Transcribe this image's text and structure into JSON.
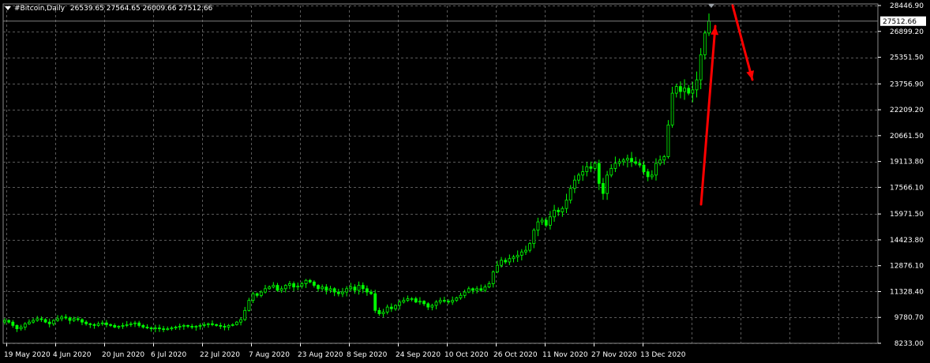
{
  "header": {
    "symbol": "#Bitcoin,Daily",
    "ohlc": "26539.65 27564.65 26009.66 27512.66"
  },
  "price_label": "27512.66",
  "colors": {
    "background": "#000000",
    "grid": "#5a5a5a",
    "candle": "#00ff00",
    "arrow": "#ff0000",
    "current_price_line": "#7f7f7f"
  },
  "chart_data": {
    "type": "candlestick",
    "symbol": "#Bitcoin",
    "timeframe": "Daily",
    "ylim": [
      8233.0,
      28446.9
    ],
    "y_ticks": [
      "28446.90",
      "26899.20",
      "25351.50",
      "23756.90",
      "22209.20",
      "20661.50",
      "19113.80",
      "17566.10",
      "15971.50",
      "14423.80",
      "12876.10",
      "11328.40",
      "9780.70",
      "8233.00"
    ],
    "y_tick_values": [
      28446.9,
      26899.2,
      25351.5,
      23756.9,
      22209.2,
      20661.5,
      19113.8,
      17566.1,
      15971.5,
      14423.8,
      12876.1,
      11328.4,
      9780.7,
      8233.0
    ],
    "x_ticks": [
      "19 May 2020",
      "4 Jun 2020",
      "20 Jun 2020",
      "6 Jul 2020",
      "22 Jul 2020",
      "7 Aug 2020",
      "23 Aug 2020",
      "8 Sep 2020",
      "24 Sep 2020",
      "10 Oct 2020",
      "26 Oct 2020",
      "11 Nov 2020",
      "27 Nov 2020",
      "13 Dec 2020"
    ],
    "grid": true,
    "last_price": 27512.66,
    "close_series": [
      9600,
      9500,
      9300,
      9100,
      9200,
      9400,
      9500,
      9600,
      9700,
      9650,
      9500,
      9400,
      9600,
      9700,
      9800,
      9750,
      9600,
      9700,
      9650,
      9500,
      9400,
      9350,
      9300,
      9400,
      9450,
      9350,
      9300,
      9200,
      9250,
      9300,
      9350,
      9400,
      9450,
      9300,
      9200,
      9150,
      9100,
      9150,
      9100,
      9050,
      9100,
      9150,
      9200,
      9250,
      9300,
      9250,
      9200,
      9250,
      9300,
      9350,
      9400,
      9350,
      9300,
      9250,
      9200,
      9300,
      9350,
      9500,
      9650,
      10200,
      10800,
      11200,
      11100,
      11300,
      11500,
      11600,
      11700,
      11400,
      11500,
      11700,
      11800,
      11600,
      11650,
      11800,
      12000,
      11900,
      11700,
      11500,
      11600,
      11400,
      11500,
      11300,
      11200,
      11300,
      11500,
      11600,
      11400,
      11700,
      11500,
      11300,
      11200,
      10200,
      10000,
      10100,
      10400,
      10300,
      10500,
      10700,
      10800,
      10900,
      10900,
      10700,
      10750,
      10600,
      10400,
      10500,
      10700,
      10800,
      10750,
      10700,
      10800,
      10950,
      11100,
      11300,
      11500,
      11400,
      11500,
      11400,
      11600,
      11800,
      12500,
      12900,
      13200,
      13100,
      13300,
      13400,
      13500,
      13700,
      13800,
      14200,
      15000,
      15500,
      15600,
      15300,
      15800,
      16200,
      16100,
      16300,
      16800,
      17500,
      18000,
      18300,
      18500,
      18800,
      18700,
      19000,
      17800,
      17200,
      18300,
      18700,
      19000,
      19100,
      19200,
      19300,
      19100,
      19000,
      18900,
      18500,
      18200,
      18300,
      19000,
      19200,
      19400,
      21300,
      23200,
      23600,
      23300,
      23500,
      23200,
      23400,
      24000,
      25500,
      26800,
      27512.66
    ],
    "annotations": [
      {
        "type": "arrow",
        "color": "#ff0000",
        "direction": "up"
      },
      {
        "type": "arrow",
        "color": "#ff0000",
        "direction": "down"
      }
    ]
  }
}
